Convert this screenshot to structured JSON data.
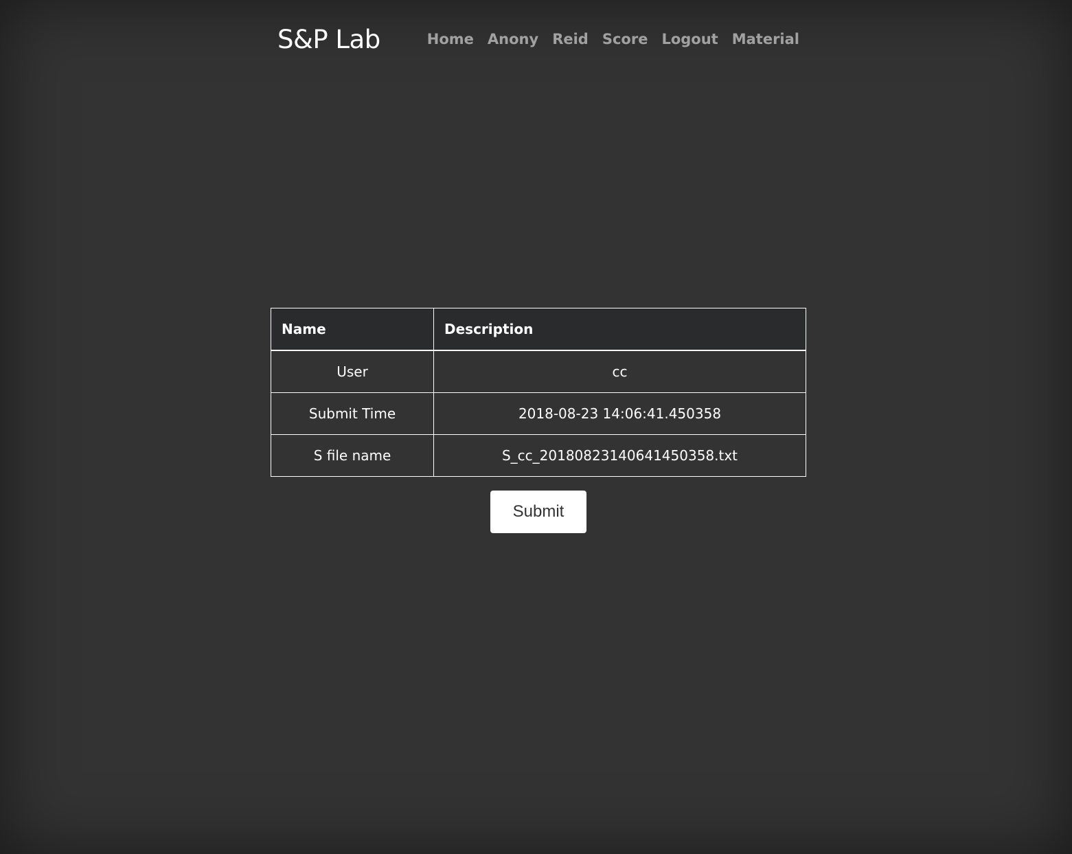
{
  "header": {
    "brand": "S&P Lab",
    "nav": [
      "Home",
      "Anony",
      "Reid",
      "Score",
      "Logout",
      "Material"
    ]
  },
  "table": {
    "columns": [
      "Name",
      "Description"
    ],
    "rows": [
      [
        "User",
        "cc"
      ],
      [
        "Submit Time",
        "2018-08-23 14:06:41.450358"
      ],
      [
        "S file name",
        "S_cc_20180823140641450358.txt"
      ]
    ]
  },
  "submit_label": "Submit",
  "colors": {
    "background": "#333333",
    "header_row": "#2a2b2d",
    "text": "#ffffff",
    "nav_text": "#9a9a9a",
    "button_bg": "#ffffff"
  }
}
